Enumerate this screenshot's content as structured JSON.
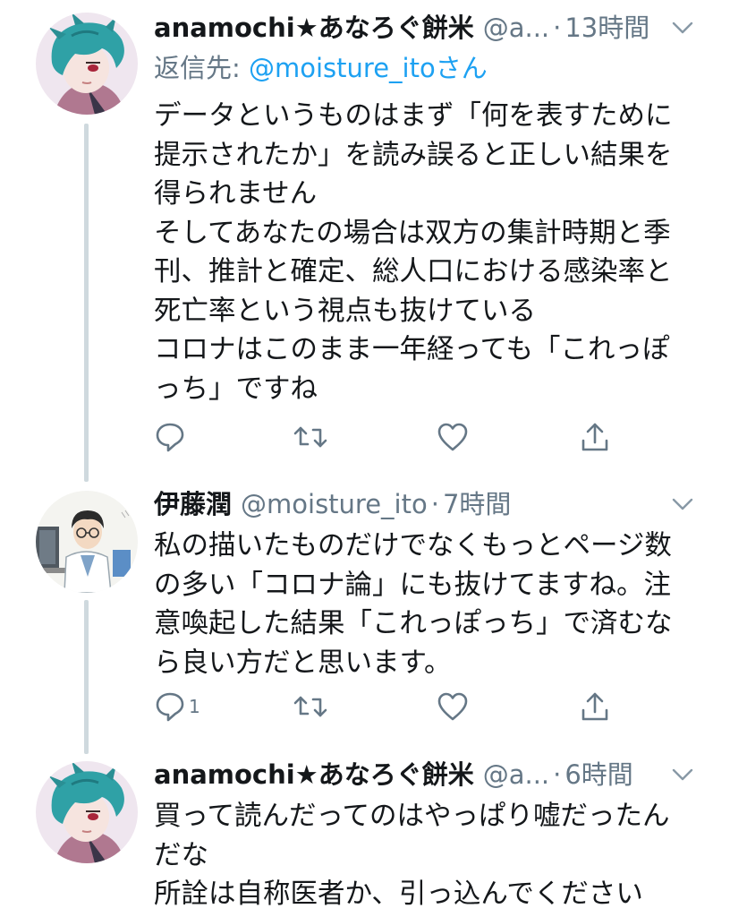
{
  "tweets": [
    {
      "name": "anamochi★あなろぐ餅米",
      "handle": "@a...",
      "dot": "·",
      "time": "13時間",
      "reply_prefix": "返信先: ",
      "reply_mention": "@moisture_itoさん",
      "text": "データというものはまず「何を表すために提示されたか」を読み誤ると正しい結果を得られません\nそしてあなたの場合は双方の集計時期と季刊、推計と確定、総人口における感染率と死亡率という視点も抜けている\nコロナはこのまま一年経っても「これっぽっち」ですね",
      "reply_count": "",
      "avatar": "anime-avatar"
    },
    {
      "name": "伊藤潤",
      "handle": "@moisture_ito",
      "dot": "·",
      "time": "7時間",
      "text": "私の描いたものだけでなくもっとページ数の多い「コロナ論」にも抜けてますね。注意喚起した結果「これっぽっち」で済むなら良い方だと思います。",
      "reply_count": "1",
      "avatar": "doctor-avatar"
    },
    {
      "name": "anamochi★あなろぐ餅米",
      "handle": "@a...",
      "dot": "·",
      "time": "6時間",
      "text": "買って読んだってのはやっぱり嘘だったんだな\n所詮は自称医者か、引っ込んでください",
      "avatar": "anime-avatar"
    }
  ],
  "icons": {
    "reply": "reply-icon",
    "retweet": "retweet-icon",
    "like": "heart-icon",
    "share": "share-icon",
    "menu": "chevron-down-icon"
  },
  "colors": {
    "text": "#14171a",
    "secondary": "#657786",
    "link": "#1da1f2",
    "thread_line": "#cfd9de"
  }
}
